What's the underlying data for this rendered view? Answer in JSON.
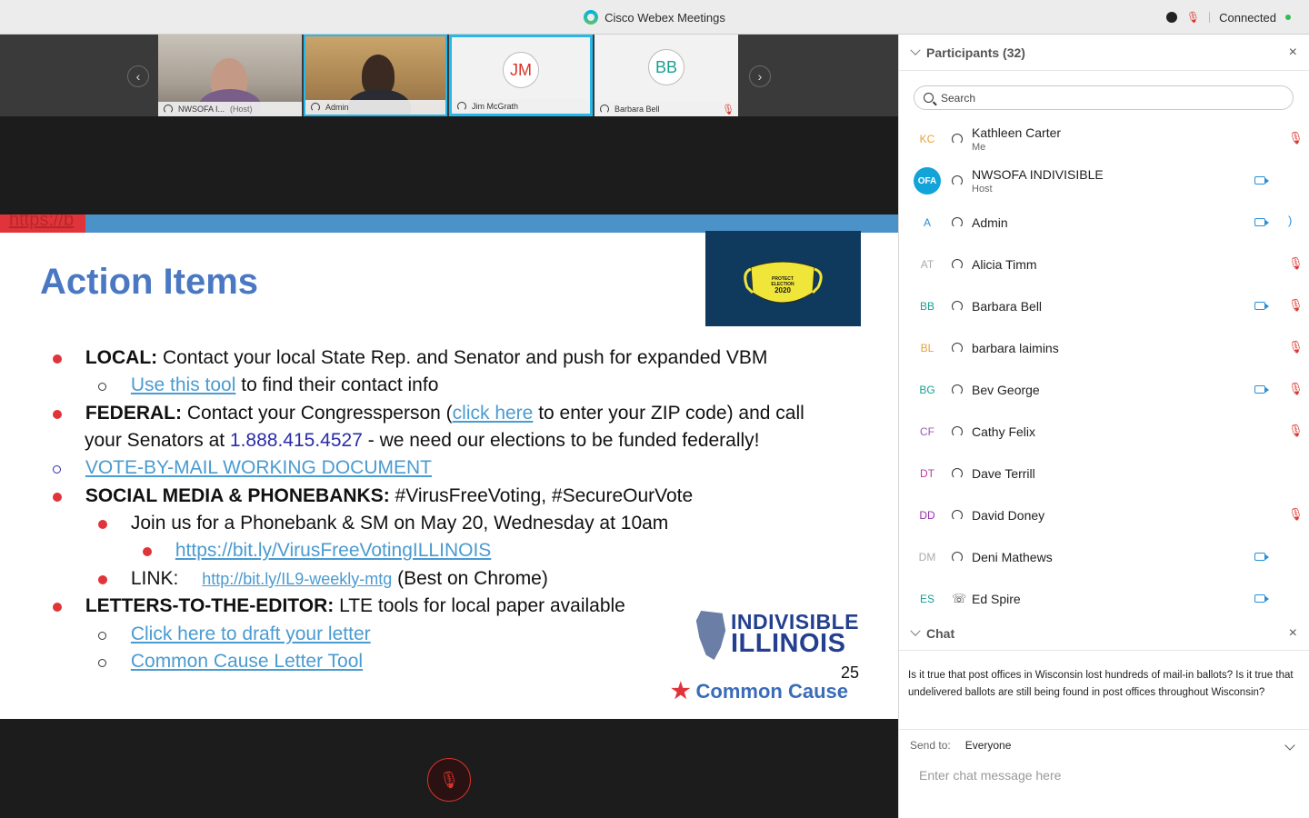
{
  "window": {
    "title": "Cisco Webex Meetings",
    "status": "Connected",
    "mute_glyph": "🎙︎"
  },
  "filmstrip": {
    "prev_glyph": "‹",
    "next_glyph": "›",
    "tiles": [
      {
        "label": "NWSOFA I...",
        "sublabel": "(Host)"
      },
      {
        "label": "Admin"
      },
      {
        "label": "Jim McGrath",
        "initials": "JM",
        "initials_color": "#d9342b"
      },
      {
        "label": "Barbara Bell",
        "initials": "BB",
        "initials_color": "#1a9f8f"
      }
    ]
  },
  "slide": {
    "top_link_fragment": "https://b",
    "title": "Action Items",
    "mask_text": [
      "PROTECT",
      "ELECTION",
      "2020"
    ],
    "lines": {
      "local_label": "LOCAL:",
      "local_text": "  Contact your local State Rep. and Senator and push for expanded VBM",
      "use_tool_link": "Use this tool",
      "use_tool_rest": " to find their contact info",
      "federal_label": "FEDERAL:",
      "federal_text_a": " Contact your Congressperson (",
      "click_here_link": "click here",
      "federal_text_b": " to enter your ZIP code) and call",
      "federal_text_c": "your Senators at ",
      "phone": "1.888.415.4527",
      "federal_text_d": " - we need our elections to be funded federally!",
      "vbm_link": "VOTE-BY-MAIL WORKING DOCUMENT",
      "social_label": "SOCIAL MEDIA & PHONEBANKS:",
      "social_text": "    #VirusFreeVoting, #SecureOurVote",
      "join_text": "Join us for a Phonebank & SM on May 20, Wednesday at 10am",
      "bitly_link": "https://bit.ly/VirusFreeVotingILLINOIS",
      "link_label": "LINK:",
      "link_url": "http://bit.ly/IL9-weekly-mtg",
      "link_note": "   (Best on Chrome)",
      "lte_label": "LETTERS-TO-THE-EDITOR:",
      "lte_text": "  LTE tools for local paper available",
      "draft_link": "Click here to draft your letter",
      "cc_link": "Common Cause Letter Tool"
    },
    "logo_indivisible": [
      "INDIVISIBLE",
      "ILLINOIS"
    ],
    "slide_number": "25",
    "logo_common_cause": "Common Cause",
    "cc_star_glyph": "★"
  },
  "participants": {
    "title": "Participants (32)",
    "close_glyph": "×",
    "search_placeholder": "Search",
    "mic_glyph": "🎙︎",
    "speak_glyph": ")",
    "phone_glyph": "☏",
    "list": [
      {
        "initials": "KC",
        "color": "#e8a13a",
        "name": "Kathleen Carter",
        "role": "Me",
        "cam": false,
        "mute": true,
        "speaking": false
      },
      {
        "initials": "OFA",
        "color": "#ffffff",
        "name": "NWSOFA INDIVISIBLE",
        "role": "Host",
        "cam": true,
        "mute": false,
        "speaking": false
      },
      {
        "initials": "A",
        "color": "#2a8fd6",
        "name": "Admin",
        "role": "",
        "cam": true,
        "mute": false,
        "speaking": true
      },
      {
        "initials": "AT",
        "color": "#aaaaaa",
        "name": "Alicia Timm",
        "role": "",
        "cam": false,
        "mute": true,
        "speaking": false
      },
      {
        "initials": "BB",
        "color": "#1a9f8f",
        "name": "Barbara Bell",
        "role": "",
        "cam": true,
        "mute": true,
        "speaking": false
      },
      {
        "initials": "BL",
        "color": "#e8a13a",
        "name": "barbara laimins",
        "role": "",
        "cam": false,
        "mute": true,
        "speaking": false
      },
      {
        "initials": "BG",
        "color": "#1a9f8f",
        "name": "Bev George",
        "role": "",
        "cam": true,
        "mute": true,
        "speaking": false
      },
      {
        "initials": "CF",
        "color": "#9b59b6",
        "name": "Cathy Felix",
        "role": "",
        "cam": false,
        "mute": true,
        "speaking": false
      },
      {
        "initials": "DT",
        "color": "#c0399b",
        "name": "Dave Terrill",
        "role": "",
        "cam": false,
        "mute": false,
        "speaking": false
      },
      {
        "initials": "DD",
        "color": "#9b2fae",
        "name": "David Doney",
        "role": "",
        "cam": false,
        "mute": true,
        "speaking": false
      },
      {
        "initials": "DM",
        "color": "#aaaaaa",
        "name": "Deni Mathews",
        "role": "",
        "cam": true,
        "mute": false,
        "speaking": false
      },
      {
        "initials": "ES",
        "color": "#1a9f8f",
        "name": "Ed Spire",
        "role": "",
        "cam": true,
        "mute": false,
        "speaking": false,
        "phone": true
      }
    ]
  },
  "chat": {
    "title": "Chat",
    "close_glyph": "×",
    "message": "Is it true that post offices in Wisconsin lost hundreds of mail-in ballots? Is it true that undelivered ballots are still being found in post offices throughout Wisconsin?",
    "send_to_label": "Send to:",
    "send_to_value": "Everyone",
    "input_placeholder": "Enter chat message here"
  }
}
